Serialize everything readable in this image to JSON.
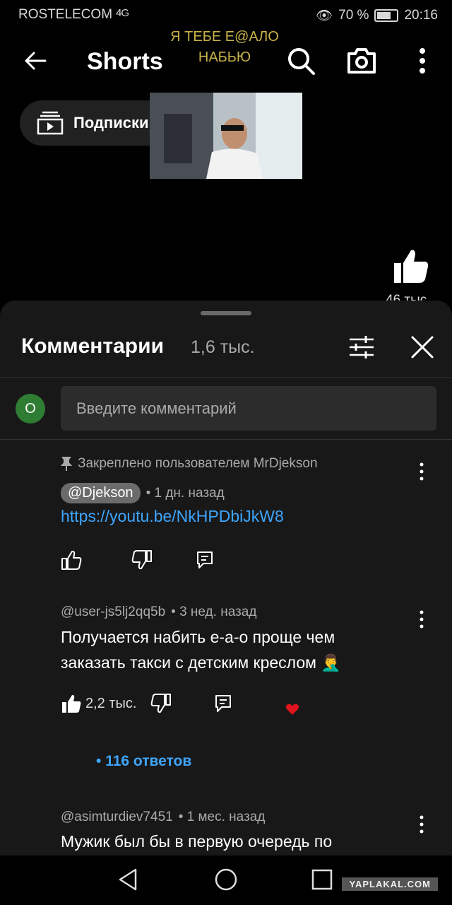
{
  "status_bar": {
    "carrier": "ROSTELECOM",
    "signal": "4G",
    "battery": "70 %",
    "battery_level": 0.7,
    "time": "20:16"
  },
  "header": {
    "title": "Shorts",
    "overlay_text_line1": "Я ТЕБЕ Е@АЛО",
    "overlay_text_line2": "НАБЬЮ"
  },
  "subscriptions": {
    "label": "Подписки"
  },
  "video": {
    "like_count": "46 тыс."
  },
  "comments": {
    "title": "Комментарии",
    "count": "1,6 тыс.",
    "input_avatar": "О",
    "input_placeholder": "Введите комментарий",
    "items": [
      {
        "pinned_text": "Закреплено пользователем MrDjekson",
        "author": "@Djekson",
        "time": "• 1 дн. назад",
        "link": "https://youtu.be/NkHPDbiJkW8"
      },
      {
        "author": "@user-js5lj2qq5b",
        "time": "• 3 нед. назад",
        "text_line1": "Получается набить е-а-о проще чем",
        "text_line2": "заказать такси с детским креслом 🤦‍♂️",
        "likes": "2,2 тыс.",
        "replies": "• 116 ответов"
      },
      {
        "author": "@asimturdiev7451",
        "time": "• 1 мес. назад",
        "text_line1": "Мужик был бы в первую очередь по"
      }
    ]
  },
  "watermark": "YAPLAKAL.COM",
  "colors": {
    "link": "#3ea6ff",
    "sheet": "#181818",
    "avatar": "#2e7d32",
    "heart": "#e0141e"
  }
}
